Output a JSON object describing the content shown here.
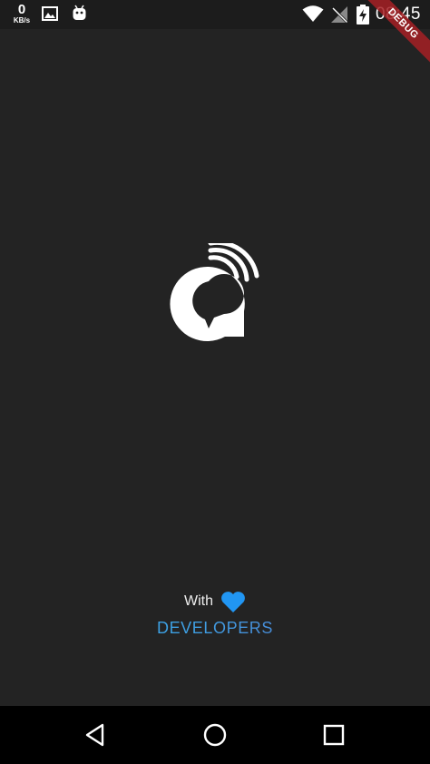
{
  "status_bar": {
    "net_speed_value": "0",
    "net_speed_unit": "KB/s",
    "time": "08:45",
    "icons": [
      "image-icon",
      "android-icon",
      "wifi-icon",
      "no-signal-icon",
      "battery-charging-icon"
    ]
  },
  "debug_banner": {
    "label": "DEBUG",
    "color": "#a62024"
  },
  "app": {
    "logo_icon": "app-logo-icon",
    "background_color": "#232323"
  },
  "credit": {
    "with_label": "With",
    "heart_icon": "heart-icon",
    "heart_color": "#2196f3",
    "developers_label": "DEVELOPERS",
    "developers_colors": [
      "#2ea7e8",
      "#5767c2"
    ]
  },
  "nav_bar": {
    "buttons": [
      "back-icon",
      "home-icon",
      "recents-icon"
    ]
  }
}
